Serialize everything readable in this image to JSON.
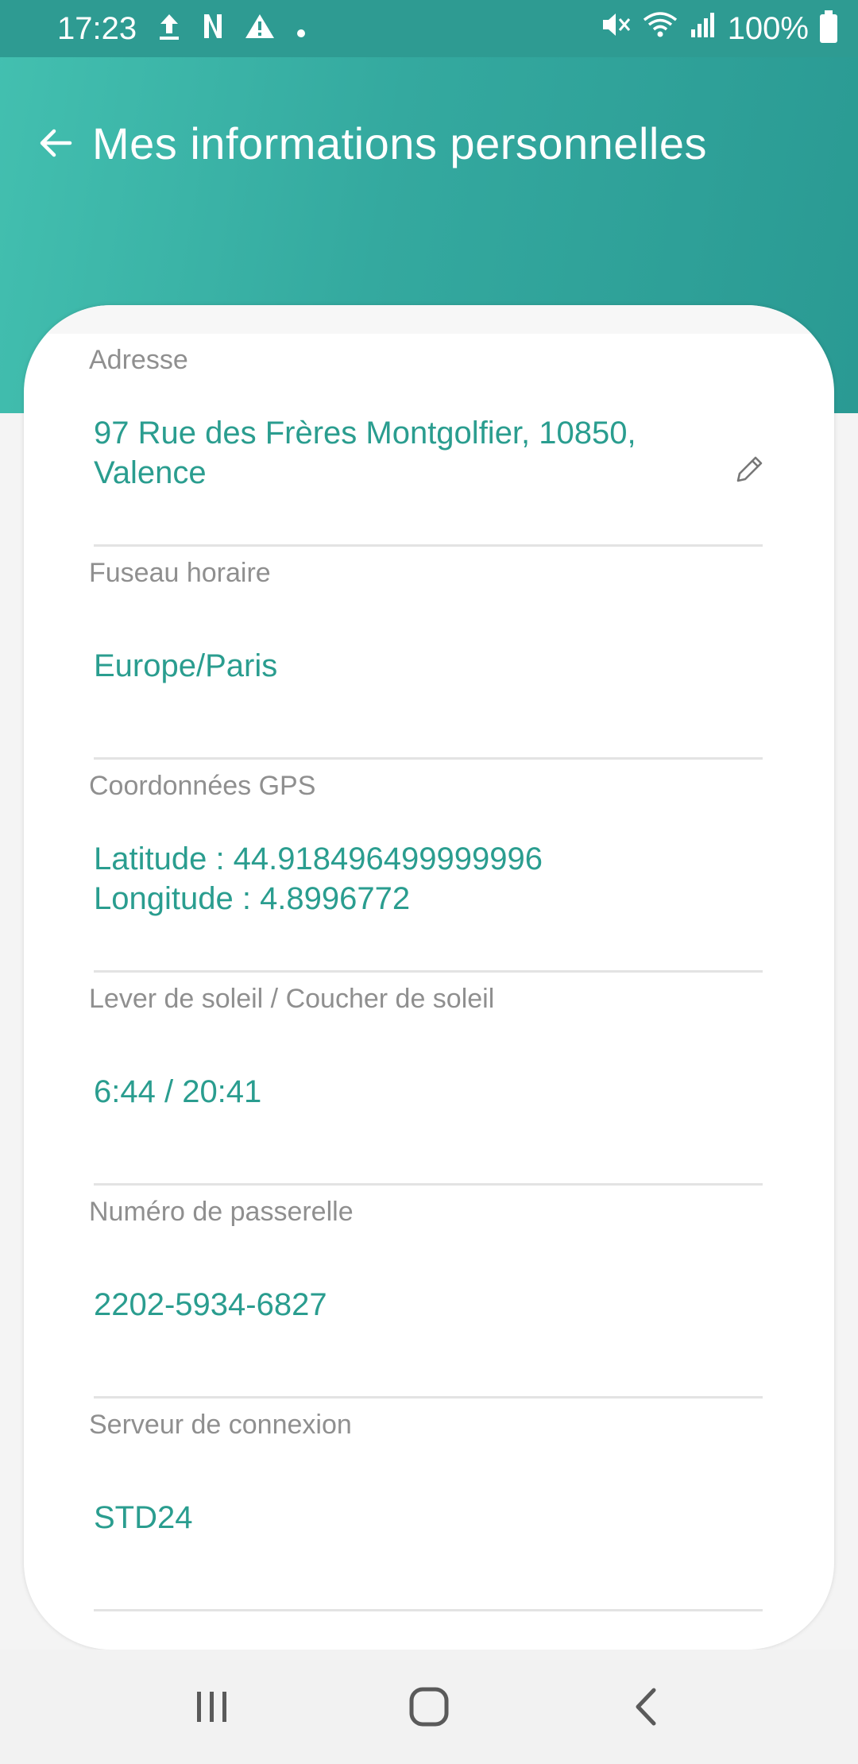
{
  "status_bar": {
    "time": "17:23",
    "battery": "100%",
    "icons": [
      "upload-icon",
      "n-app-icon",
      "warning-icon",
      "dot-icon",
      "mute-icon",
      "wifi-icon",
      "signal-icon",
      "battery-icon"
    ]
  },
  "header": {
    "title": "Mes informations personnelles",
    "back_icon": "arrow-left-icon"
  },
  "fields": [
    {
      "label": "Adresse",
      "lines": [
        "97 Rue des Frères Montgolfier, 10850,",
        "Valence"
      ],
      "editable": true
    },
    {
      "label": "Fuseau horaire",
      "lines": [
        "Europe/Paris"
      ]
    },
    {
      "label": "Coordonnées GPS",
      "lines": [
        "Latitude : 44.918496499999996",
        "Longitude : 4.8996772"
      ]
    },
    {
      "label": "Lever de soleil / Coucher de soleil",
      "lines": [
        "6:44 / 20:41"
      ]
    },
    {
      "label": "Numéro de passerelle",
      "lines": [
        "2202-5934-6827"
      ]
    },
    {
      "label": "Serveur de connexion",
      "lines": [
        "STD24"
      ]
    }
  ],
  "colors": {
    "accent": "#2a9d8f",
    "header_start": "#43c0b0",
    "header_end": "#2a9a93",
    "label": "#8f8f8f"
  },
  "nav": [
    "recent-apps-icon",
    "home-icon",
    "back-icon"
  ]
}
